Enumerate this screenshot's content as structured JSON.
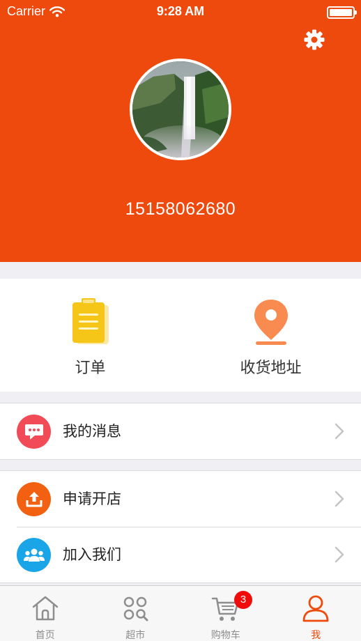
{
  "status_bar": {
    "carrier": "Carrier",
    "time": "9:28 AM"
  },
  "profile": {
    "phone": "15158062680"
  },
  "quick_actions": [
    {
      "label": "订单",
      "icon": "clipboard-icon",
      "color": "#f5c518"
    },
    {
      "label": "收货地址",
      "icon": "location-pin-icon",
      "color": "#f98a50"
    }
  ],
  "menu_groups": [
    [
      {
        "label": "我的消息",
        "icon": "chat-bubble-icon",
        "color": "#f24b58"
      }
    ],
    [
      {
        "label": "申请开店",
        "icon": "upload-tray-icon",
        "color": "#f26012"
      },
      {
        "label": "加入我们",
        "icon": "group-icon",
        "color": "#1aa5e8"
      }
    ]
  ],
  "tabbar": {
    "items": [
      {
        "label": "首页",
        "icon": "home-icon"
      },
      {
        "label": "超市",
        "icon": "grid-search-icon"
      },
      {
        "label": "购物车",
        "icon": "cart-icon"
      },
      {
        "label": "我",
        "icon": "person-icon",
        "active": true
      }
    ],
    "cart_badge": "3"
  },
  "colors": {
    "accent": "#ee4a0e",
    "background": "#efeff4"
  }
}
